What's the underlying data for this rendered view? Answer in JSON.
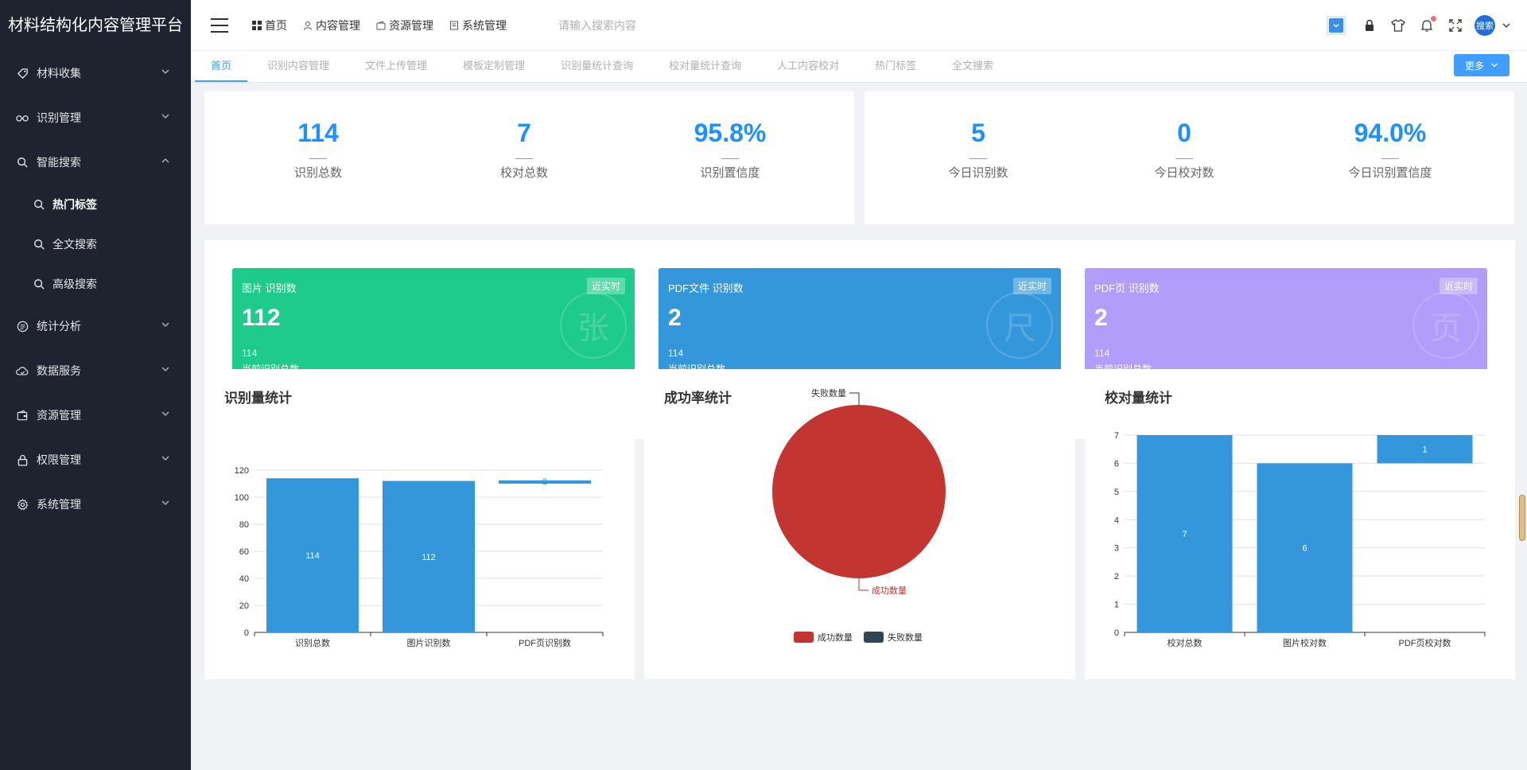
{
  "app": {
    "title": "材料结构化内容管理平台"
  },
  "sidebar": {
    "items": [
      {
        "label": "材料收集",
        "icon": "tag-icon",
        "expanded": false
      },
      {
        "label": "识别管理",
        "icon": "glasses-icon",
        "expanded": false
      },
      {
        "label": "智能搜索",
        "icon": "search-icon",
        "expanded": true,
        "children": [
          {
            "label": "热门标签",
            "active": true
          },
          {
            "label": "全文搜索",
            "active": false
          },
          {
            "label": "高级搜索",
            "active": false
          }
        ]
      },
      {
        "label": "统计分析",
        "icon": "chart-icon",
        "expanded": false
      },
      {
        "label": "数据服务",
        "icon": "cloud-icon",
        "expanded": false
      },
      {
        "label": "资源管理",
        "icon": "wallet-icon",
        "expanded": false
      },
      {
        "label": "权限管理",
        "icon": "lock-icon",
        "expanded": false
      },
      {
        "label": "系统管理",
        "icon": "gear-icon",
        "expanded": false
      }
    ]
  },
  "header": {
    "nav": [
      {
        "label": "首页",
        "icon": "grid-icon"
      },
      {
        "label": "内容管理",
        "icon": "user-icon"
      },
      {
        "label": "资源管理",
        "icon": "wallet-icon"
      },
      {
        "label": "系统管理",
        "icon": "doc-icon"
      }
    ],
    "search_placeholder": "请输入搜索内容",
    "avatar_text": "搜索"
  },
  "tabs": [
    {
      "label": "首页",
      "active": true
    },
    {
      "label": "识别内容管理",
      "active": false
    },
    {
      "label": "文件上传管理",
      "active": false
    },
    {
      "label": "模板定制管理",
      "active": false
    },
    {
      "label": "识别量统计查询",
      "active": false
    },
    {
      "label": "校对量统计查询",
      "active": false
    },
    {
      "label": "人工内容校对",
      "active": false
    },
    {
      "label": "热门标签",
      "active": false
    },
    {
      "label": "全文搜索",
      "active": false
    }
  ],
  "more_label": "更多",
  "stats_left": [
    {
      "value": "114",
      "label": "识别总数"
    },
    {
      "value": "7",
      "label": "校对总数"
    },
    {
      "value": "95.8%",
      "label": "识别置信度"
    }
  ],
  "stats_right": [
    {
      "value": "5",
      "label": "今日识别数"
    },
    {
      "value": "0",
      "label": "今日校对数"
    },
    {
      "value": "94.0%",
      "label": "今日识别置信度"
    }
  ],
  "tiles": [
    {
      "title": "图片 识别数",
      "badge": "近实时",
      "value": "112",
      "sub": "114",
      "sub_label": "当前识别总数",
      "watermark": "张",
      "color": "#1ecb8c"
    },
    {
      "title": "PDF文件 识别数",
      "badge": "近实时",
      "value": "2",
      "sub": "114",
      "sub_label": "当前识别总数",
      "watermark": "尺",
      "color": "#3597db"
    },
    {
      "title": "PDF页 识别数",
      "badge": "近实时",
      "value": "2",
      "sub": "114",
      "sub_label": "当前识别总数",
      "watermark": "页",
      "color": "#b39dfa"
    }
  ],
  "chart_titles": {
    "recog": "识别量统计",
    "success": "成功率统计",
    "proof": "校对量统计"
  },
  "chart_data": [
    {
      "type": "bar",
      "title": "识别量统计",
      "categories": [
        "识别总数",
        "图片识别数",
        "PDF页识别数"
      ],
      "values": [
        114,
        112,
        2
      ],
      "ylim": [
        0,
        120
      ],
      "yticks": [
        0,
        20,
        40,
        60,
        80,
        100,
        120
      ],
      "color": "#3597db"
    },
    {
      "type": "pie",
      "title": "成功率统计",
      "labels": [
        "成功数量",
        "失败数量"
      ],
      "values": [
        114,
        0
      ],
      "colors": [
        "#c23531",
        "#2f4554"
      ],
      "legend": "bottom"
    },
    {
      "type": "bar",
      "title": "校对量统计",
      "categories": [
        "校对总数",
        "图片校对数",
        "PDF页校对数"
      ],
      "values": [
        7,
        6,
        1
      ],
      "ylim": [
        0,
        7
      ],
      "yticks": [
        0,
        1,
        2,
        3,
        4,
        5,
        6,
        7
      ],
      "color": "#3597db"
    }
  ]
}
